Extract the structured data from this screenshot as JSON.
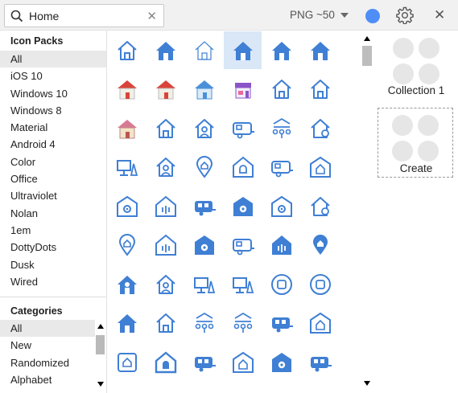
{
  "search": {
    "value": "Home"
  },
  "toolbar": {
    "format_label": "PNG ~50",
    "accent_color": "#4f8ef7"
  },
  "left": {
    "packs_title": "Icon Packs",
    "packs": [
      "All",
      "iOS 10",
      "Windows 10",
      "Windows 8",
      "Material",
      "Android 4",
      "Color",
      "Office",
      "Ultraviolet",
      "Nolan",
      "1em",
      "DottyDots",
      "Dusk",
      "Wired"
    ],
    "selected_pack": "All",
    "categories_title": "Categories",
    "categories": [
      "All",
      "New",
      "Randomized",
      "Alphabet"
    ],
    "selected_category": "All"
  },
  "collections": [
    {
      "label": "Collection 1"
    }
  ],
  "create_label": "Create",
  "icons": [
    [
      "house-outline-icon",
      "house-filled-icon",
      "house-thin-icon",
      "house-filled-icon",
      "house-filled-icon",
      "house-filled-icon"
    ],
    [
      "house-color-red-icon",
      "house-color-red-icon",
      "house-color-blue-icon",
      "shop-color-icon",
      "house-outline-icon",
      "house-outline-icon"
    ],
    [
      "house-color-pink-icon",
      "house-outline-icon",
      "home-user-icon",
      "caravan-icon",
      "home-network-icon",
      "home-settings-icon"
    ],
    [
      "home-office-icon",
      "home-user-icon",
      "home-location-icon",
      "home-alarm-icon",
      "caravan-icon",
      "home-badge-icon"
    ],
    [
      "home-gear-icon",
      "home-sound-icon",
      "caravan-filled-icon",
      "home-gear-filled-icon",
      "home-gear-icon",
      "home-settings-icon"
    ],
    [
      "home-location-icon",
      "home-sound-icon",
      "home-gear-filled-icon",
      "caravan-icon",
      "home-sound-filled-icon",
      "home-location-filled-icon"
    ],
    [
      "home-user-filled-icon",
      "home-user-icon",
      "home-office-icon",
      "home-office-icon",
      "home-button-icon",
      "home-button-icon"
    ],
    [
      "house-filled-icon",
      "house-outline-icon",
      "home-network-icon",
      "home-network-icon",
      "caravan-filled-icon",
      "home-badge-icon"
    ],
    [
      "home-frame-icon",
      "home-alarm-filled-icon",
      "caravan-filled-icon",
      "home-badge-icon",
      "home-gear-filled-icon",
      "caravan-filled-icon"
    ]
  ]
}
